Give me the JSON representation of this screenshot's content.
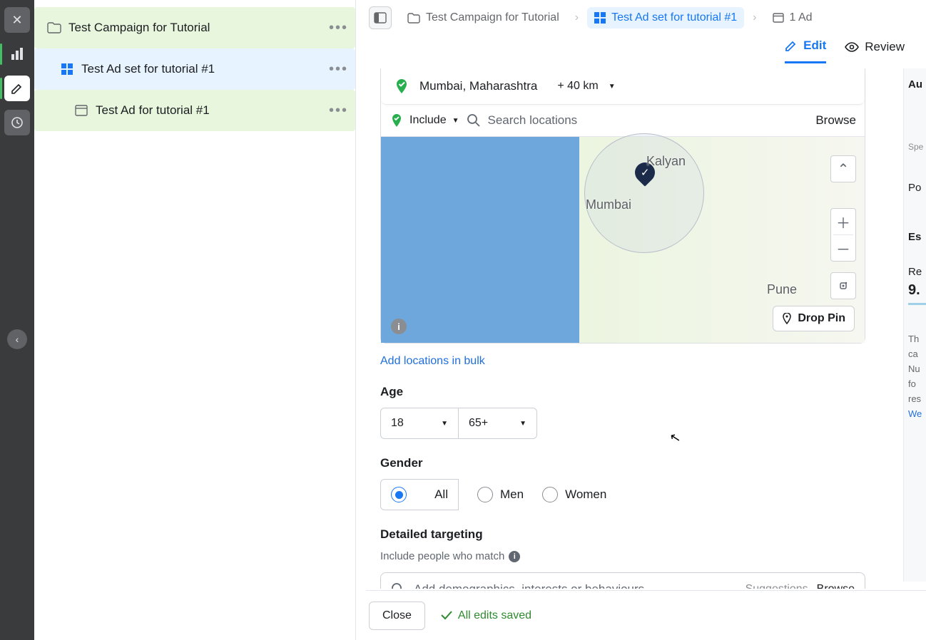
{
  "rail": {
    "collapse_icon": "‹"
  },
  "tree": {
    "campaign": "Test Campaign for Tutorial",
    "adset": "Test Ad set for tutorial #1",
    "ad": "Test Ad for tutorial #1"
  },
  "breadcrumbs": {
    "campaign": "Test Campaign for Tutorial",
    "adset": "Test Ad set for tutorial #1",
    "ad": "1 Ad"
  },
  "tabs": {
    "edit": "Edit",
    "review": "Review"
  },
  "location": {
    "place": "Mumbai, Maharashtra",
    "radius": "+ 40 km",
    "include": "Include",
    "search_placeholder": "Search locations",
    "browse": "Browse",
    "bulk_link": "Add locations in bulk",
    "drop_pin": "Drop Pin"
  },
  "map_labels": {
    "mumbai": "Mumbai",
    "kalyan": "Kalyan",
    "pune": "Pune"
  },
  "age": {
    "label": "Age",
    "min": "18",
    "max": "65+"
  },
  "gender": {
    "label": "Gender",
    "all": "All",
    "men": "Men",
    "women": "Women"
  },
  "targeting": {
    "label": "Detailed targeting",
    "sub": "Include people who match",
    "placeholder": "Add demographics, interests or behaviours",
    "suggestions": "Suggestions",
    "browse": "Browse"
  },
  "footer": {
    "close": "Close",
    "saved": "All edits saved"
  },
  "side": {
    "a": "Au",
    "spec": "Spe",
    "po": "Po",
    "es": "Es",
    "re": "Re",
    "n9": "9.",
    "th": "Th",
    "ca": "ca",
    "nu": "Nu",
    "fo": "fo",
    "res": "res",
    "we": "We"
  }
}
